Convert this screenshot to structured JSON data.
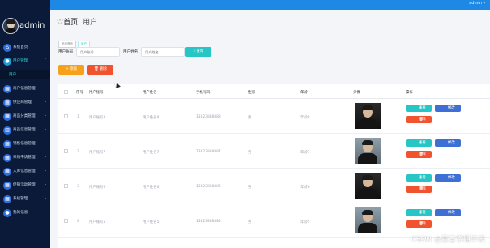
{
  "app": {
    "brand": "admin",
    "user_menu": "admin ▾"
  },
  "sidebar": {
    "items": [
      {
        "label": "系统首页",
        "icon": "home-icon"
      },
      {
        "label": "用户管理",
        "icon": "user-icon",
        "active": true
      },
      {
        "label": "用户",
        "sub": true
      },
      {
        "label": "商户信息管理",
        "icon": "grid-icon"
      },
      {
        "label": "供应商管理",
        "icon": "grid-icon"
      },
      {
        "label": "商品分类管理",
        "icon": "grid-icon"
      },
      {
        "label": "商品信息管理",
        "icon": "chart-icon"
      },
      {
        "label": "销售信息管理",
        "icon": "grid-icon"
      },
      {
        "label": "采购申请管理",
        "icon": "grid-icon"
      },
      {
        "label": "入库信息管理",
        "icon": "grid-icon"
      },
      {
        "label": "促销活动管理",
        "icon": "grid-icon"
      },
      {
        "label": "系统管理",
        "icon": "grid-icon"
      },
      {
        "label": "我的信息",
        "icon": "user-icon"
      }
    ]
  },
  "page": {
    "title": "首页",
    "subtitle": "用户",
    "breadcrumbs": [
      "系统首页",
      "用户"
    ]
  },
  "search": {
    "account_label": "用户账号",
    "account_placeholder": "用户账号",
    "name_label": "用户姓名",
    "name_placeholder": "用户姓名",
    "search_button": "查询"
  },
  "toolbar": {
    "add_label": "添加",
    "delete_label": "删除"
  },
  "table": {
    "headers": [
      "序号",
      "用户账号",
      "用户姓名",
      "手机号码",
      "性别",
      "年龄",
      "头像",
      "操作"
    ],
    "rows": [
      {
        "index": "1",
        "account": "用户账号8",
        "name": "用户姓名8",
        "phone": "13823888888",
        "gender": "男",
        "age": "年龄8"
      },
      {
        "index": "2",
        "account": "用户账号7",
        "name": "用户姓名7",
        "phone": "13823888887",
        "gender": "男",
        "age": "年龄7"
      },
      {
        "index": "3",
        "account": "用户账号6",
        "name": "用户姓名6",
        "phone": "13823888886",
        "gender": "男",
        "age": "年龄6"
      },
      {
        "index": "4",
        "account": "用户账号5",
        "name": "用户姓名5",
        "phone": "13823888885",
        "gender": "男",
        "age": "年龄5"
      }
    ],
    "actions": {
      "view": "查看",
      "edit": "修改",
      "delete": "删除"
    }
  },
  "watermark": "CSDN @霍言学姐毕设"
}
